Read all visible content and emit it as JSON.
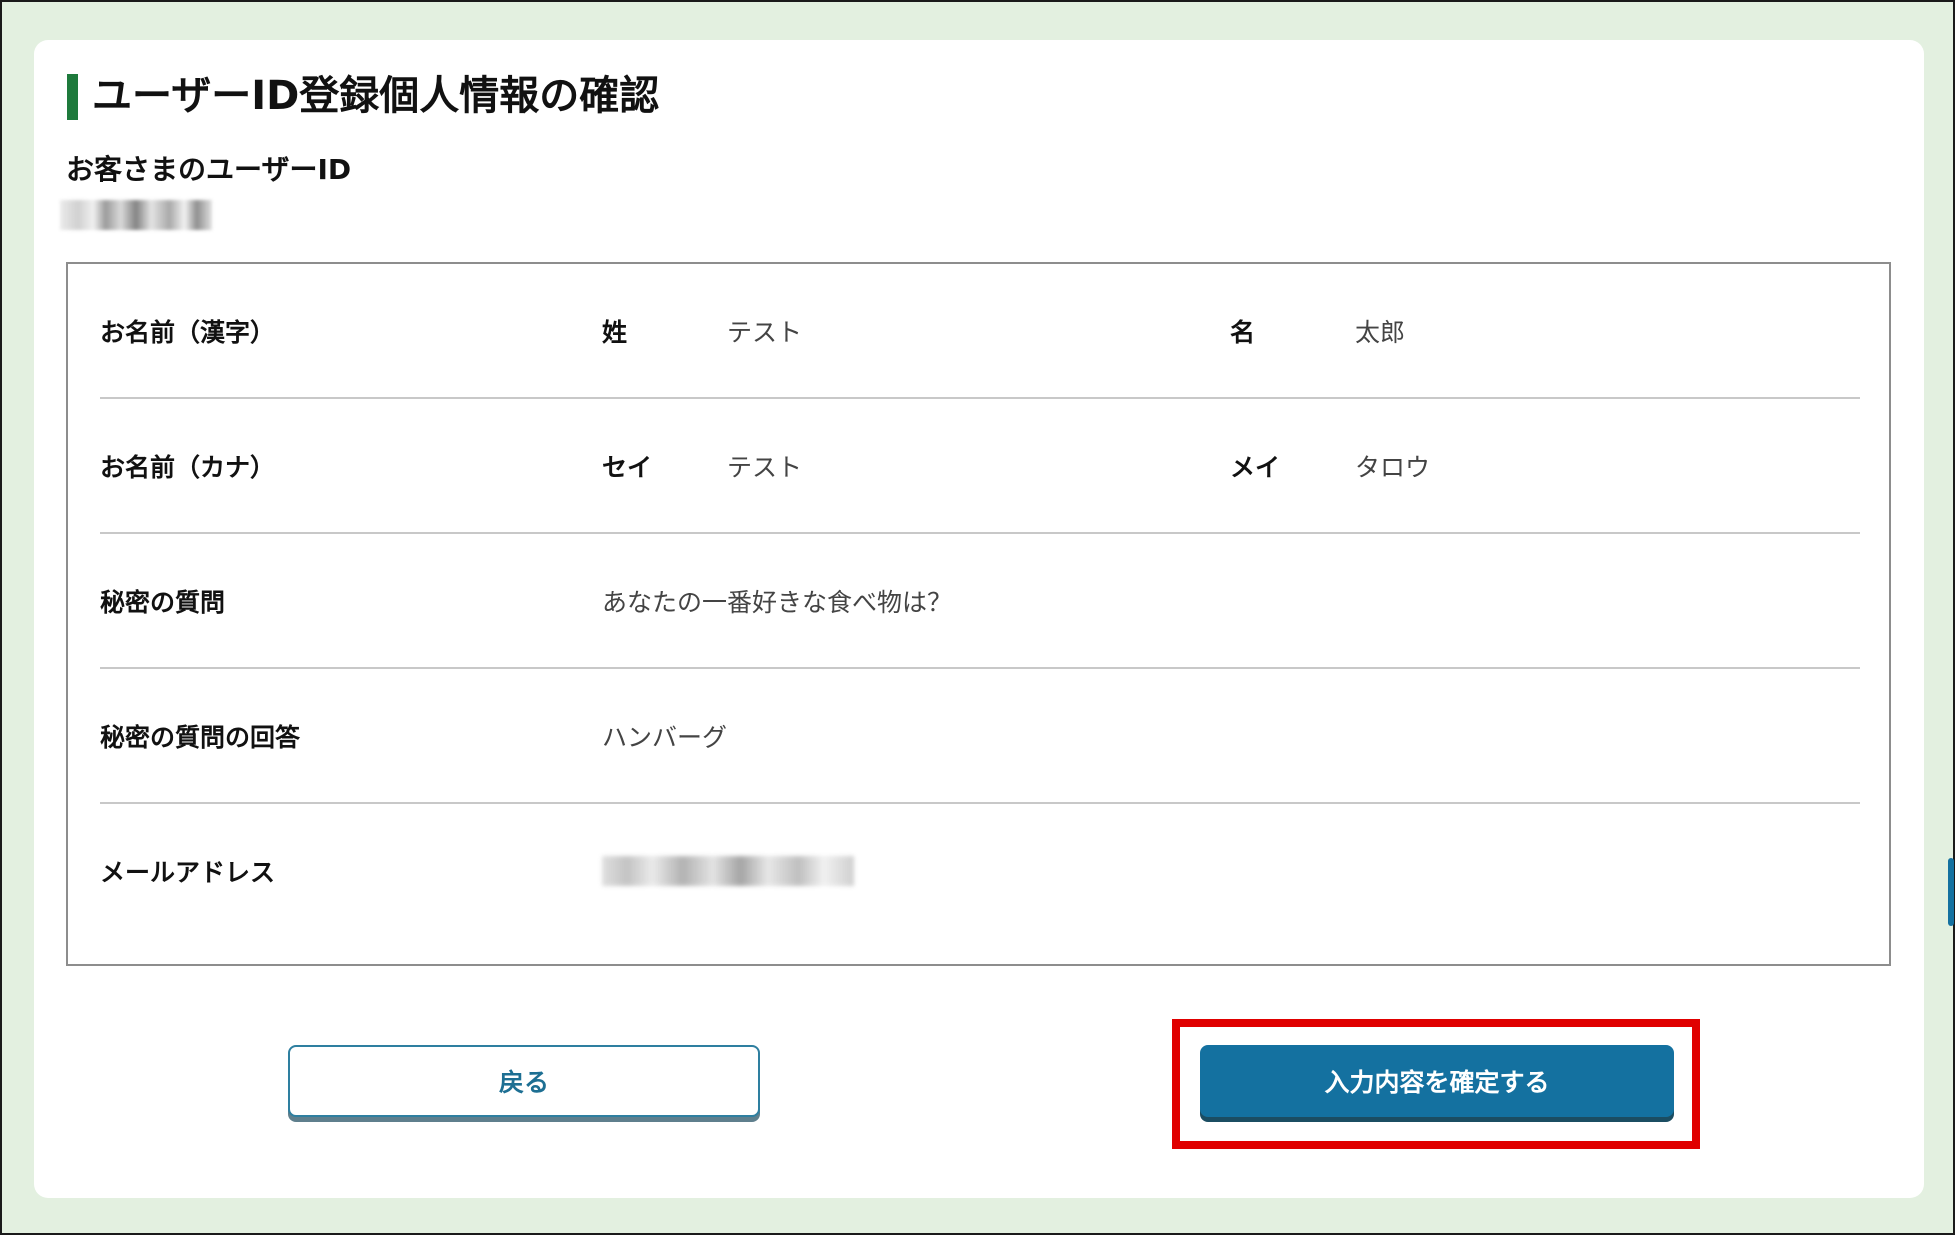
{
  "page": {
    "title": "ユーザーID登録個人情報の確認"
  },
  "user_id": {
    "label": "お客さまのユーザーID",
    "value_obscured": true
  },
  "fields": {
    "name_kanji": {
      "label": "お名前（漢字）",
      "sei_label": "姓",
      "sei_value": "テスト",
      "mei_label": "名",
      "mei_value": "太郎"
    },
    "name_kana": {
      "label": "お名前（カナ）",
      "sei_label": "セイ",
      "sei_value": "テスト",
      "mei_label": "メイ",
      "mei_value": "タロウ"
    },
    "secret_question": {
      "label": "秘密の質問",
      "value": "あなたの一番好きな食べ物は？"
    },
    "secret_answer": {
      "label": "秘密の質問の回答",
      "value": "ハンバーグ"
    },
    "email": {
      "label": "メールアドレス",
      "value_obscured": true
    }
  },
  "buttons": {
    "back_label": "戻る",
    "confirm_label": "入力内容を確定する"
  },
  "colors": {
    "page_background": "#e3f0e0",
    "title_accent": "#1e7a3c",
    "primary_button": "#1471a0",
    "highlight_border": "#e00000"
  }
}
